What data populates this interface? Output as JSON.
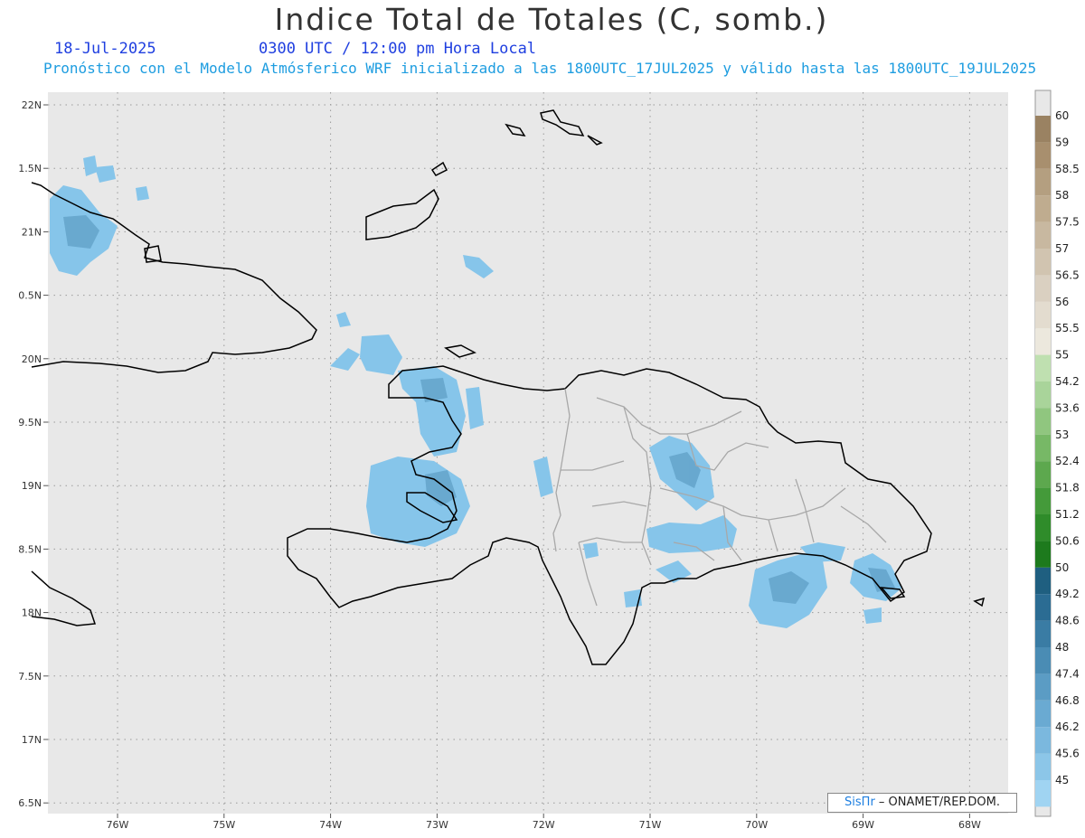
{
  "title": "Indice Total de Totales (C, somb.)",
  "date": "18-Jul-2025",
  "time": "0300 UTC / 12:00 pm Hora Local",
  "forecast_line": "Pronóstico con el Modelo Atmósferico WRF inicializado a las 1800UTC_17JUL2025 y válido hasta las  1800UTC_19JUL2025",
  "credit": {
    "brand": "SisПr",
    "text": " – ONAMET/REP.DOM."
  },
  "lat_labels": [
    "22N",
    "1.5N",
    "21N",
    "0.5N",
    "20N",
    "9.5N",
    "19N",
    "8.5N",
    "18N",
    "7.5N",
    "17N",
    "6.5N"
  ],
  "lon_labels": [
    "76W",
    "75W",
    "74W",
    "73W",
    "72W",
    "71W",
    "70W",
    "69W",
    "68W"
  ],
  "colorbar_labels": [
    "60",
    "59",
    "58.5",
    "58",
    "57.5",
    "57",
    "56.5",
    "56",
    "55.5",
    "55",
    "54.2",
    "53.6",
    "53",
    "52.4",
    "51.8",
    "51.2",
    "50.6",
    "50",
    "49.2",
    "48.6",
    "48",
    "47.4",
    "46.8",
    "46.2",
    "45.6",
    "45"
  ],
  "colorbar_colors": [
    "#9a8262",
    "#a88f6e",
    "#b49f80",
    "#bfac8f",
    "#c8b8a0",
    "#d1c4b0",
    "#dad0c1",
    "#e3dccf",
    "#ece8dd",
    "#bfe0b0",
    "#a9d49a",
    "#90c67f",
    "#77b866",
    "#5da84e",
    "#449a3a",
    "#2f8c2a",
    "#1d7a1d",
    "#1f5f80",
    "#2b6c93",
    "#3a7ca4",
    "#4a8cb4",
    "#5b9cc4",
    "#6aaad2",
    "#7bb8de",
    "#8cc6e8",
    "#a0d4f2"
  ],
  "map_background": "#e8e8e8",
  "shade_color": "#86c5ea"
}
